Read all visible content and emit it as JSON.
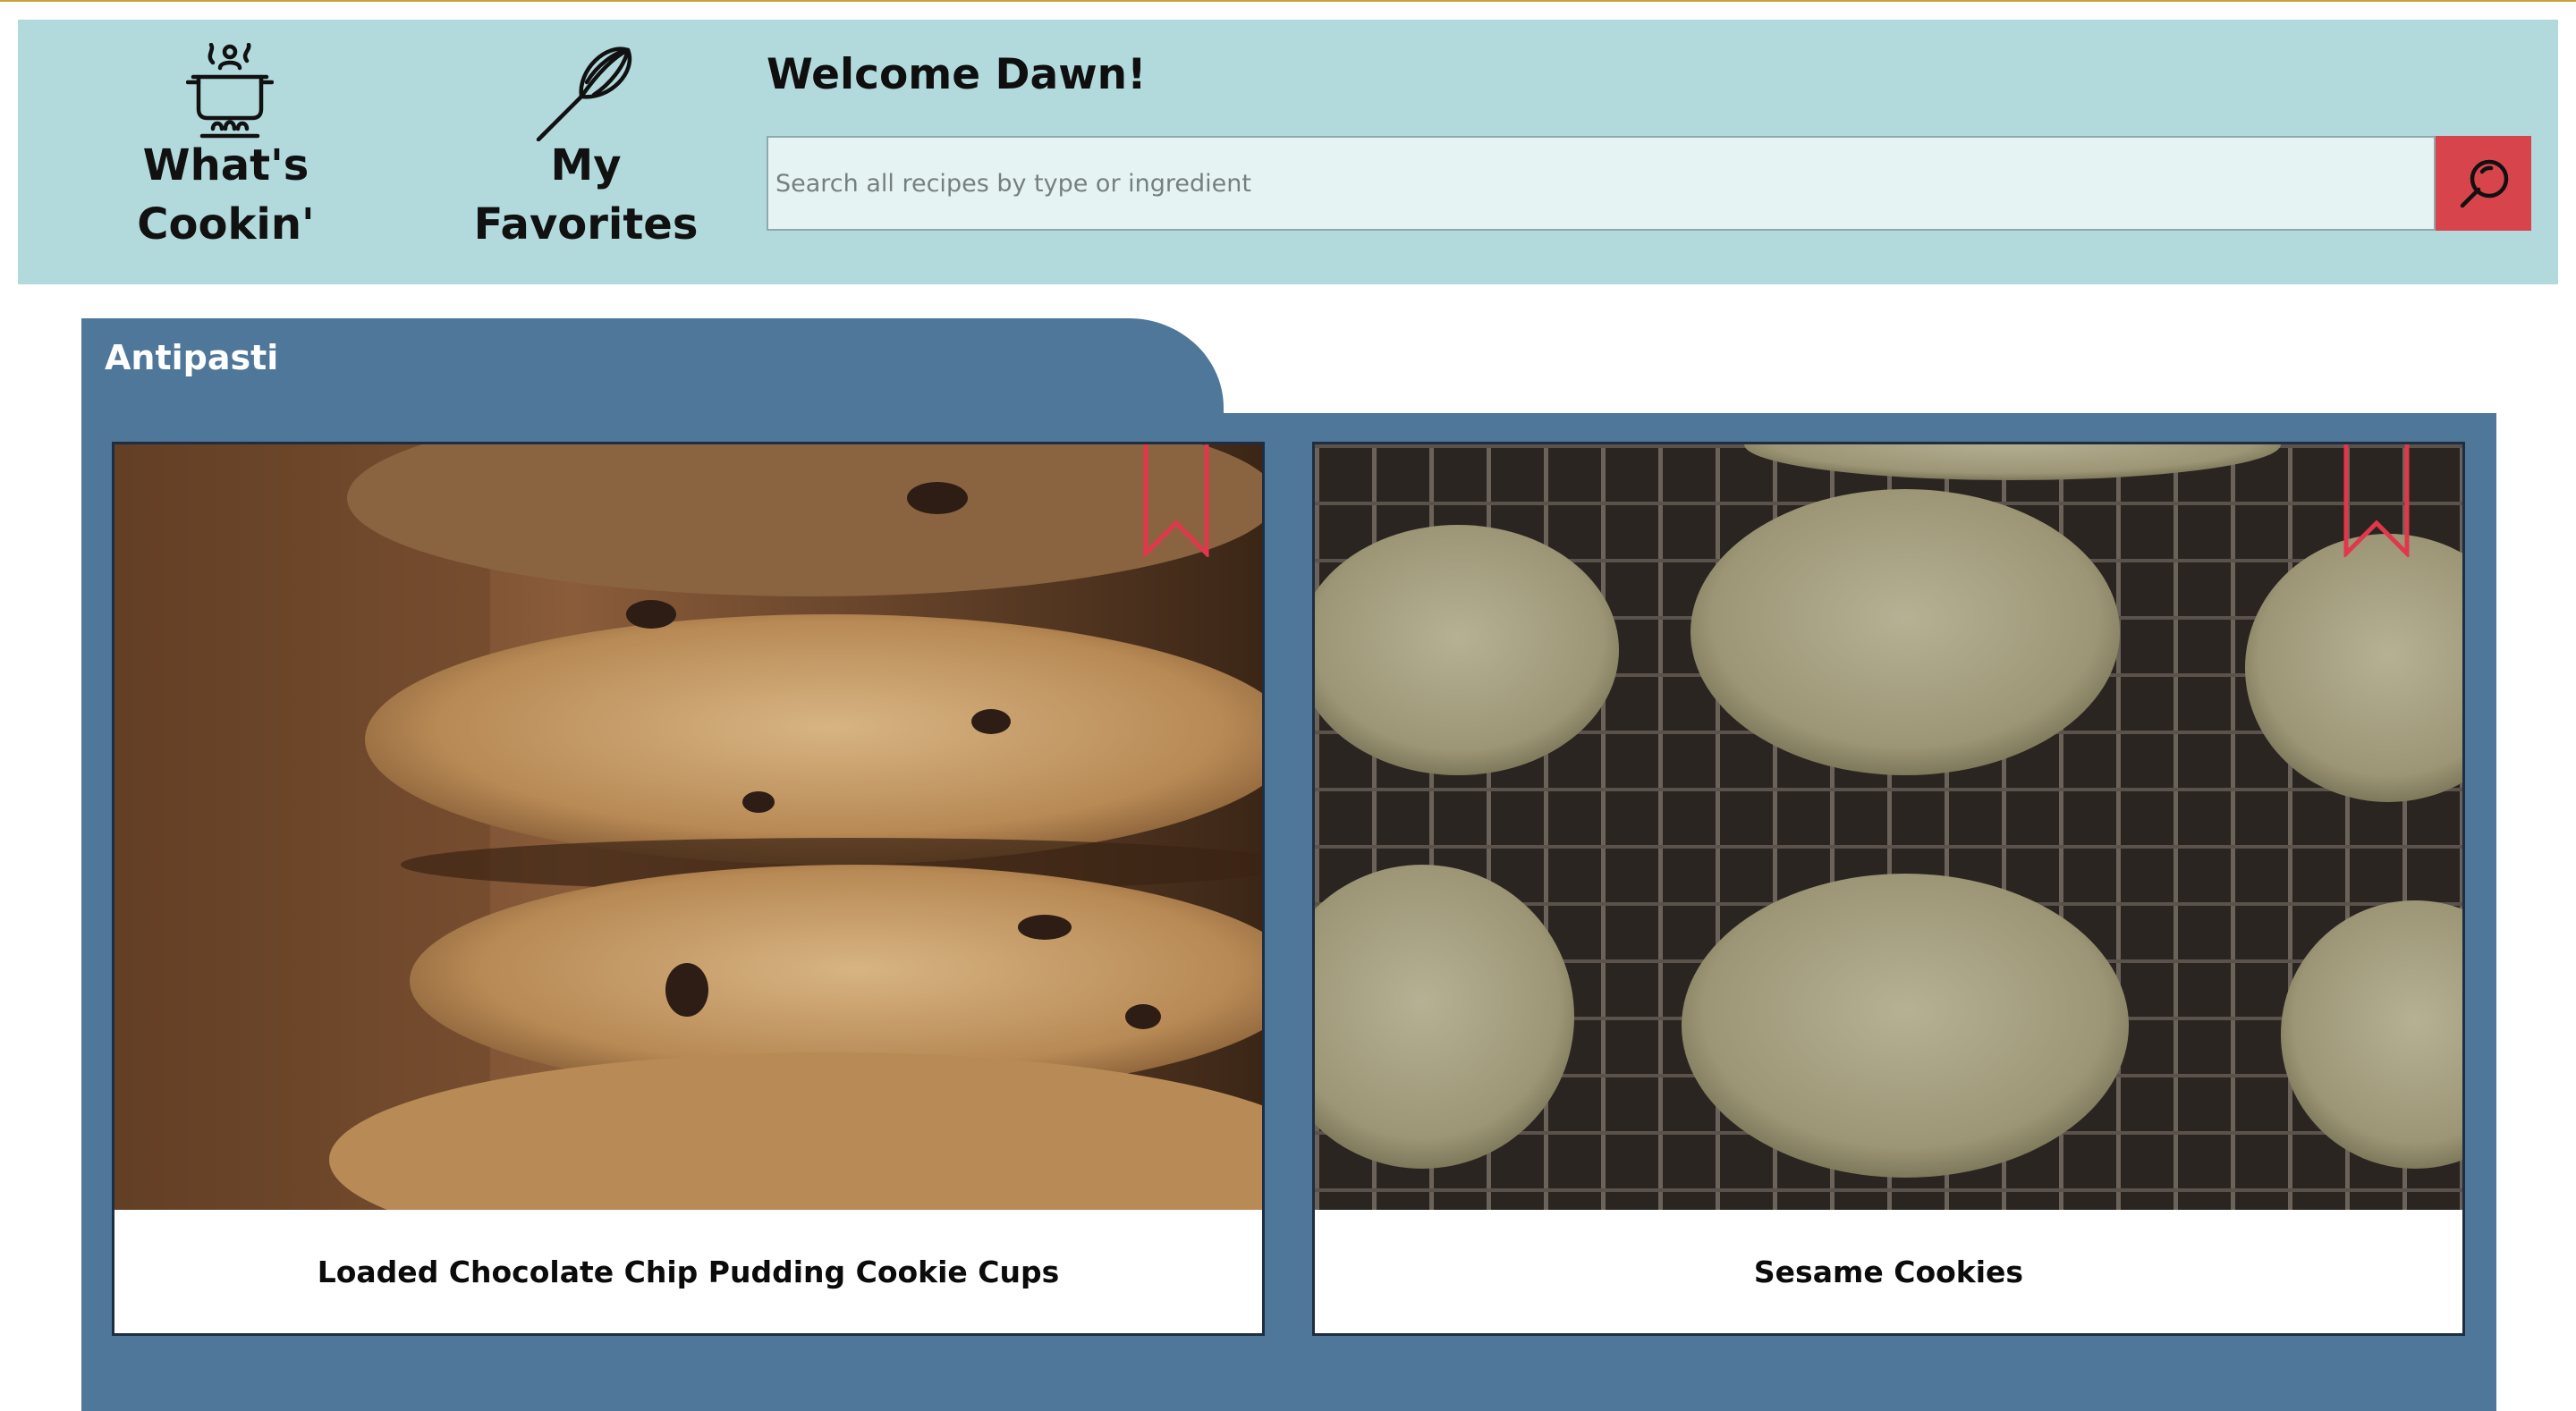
{
  "header": {
    "nav": [
      {
        "label_line1": "What's",
        "label_line2": "Cookin'",
        "icon": "cooking-pot-icon"
      },
      {
        "label_line1": "My",
        "label_line2": "Favorites",
        "icon": "whisk-icon"
      }
    ],
    "welcome": "Welcome Dawn!",
    "search": {
      "placeholder": "Search all recipes by type or ingredient",
      "value": "",
      "button_icon": "search-icon"
    }
  },
  "section": {
    "title": "Antipasti",
    "cards": [
      {
        "title": "Loaded Chocolate Chip Pudding Cookie Cups",
        "image": "chocolate-chip-cookie-stack-photo",
        "bookmark_icon": "bookmark-icon"
      },
      {
        "title": "Sesame Cookies",
        "image": "sesame-cookies-on-rack-photo",
        "bookmark_icon": "bookmark-icon"
      }
    ]
  },
  "colors": {
    "header_bg": "#b2dadc",
    "section_bg": "#4e7799",
    "search_button": "#d8444b",
    "bookmark": "#e0384a",
    "top_rule": "#c7a43a"
  }
}
